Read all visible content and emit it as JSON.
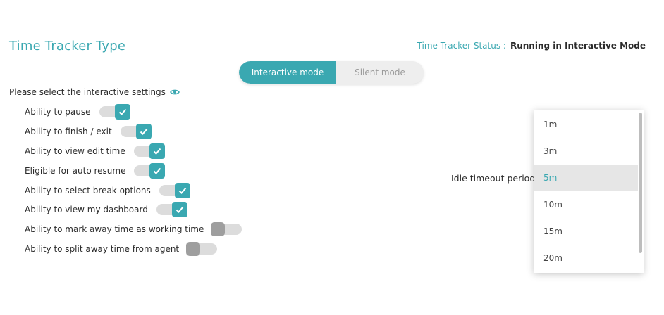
{
  "header": {
    "title": "Time Tracker Type",
    "status_label": "Time Tracker Status :",
    "status_value": "Running in Interactive Mode"
  },
  "mode_toggle": {
    "options": [
      {
        "label": "Interactive mode",
        "active": true
      },
      {
        "label": "Silent mode",
        "active": false
      }
    ]
  },
  "settings": {
    "section_label": "Please select the interactive settings",
    "section_icon": "eye-icon",
    "items": [
      {
        "label": "Ability to pause",
        "enabled": true
      },
      {
        "label": "Ability to finish / exit",
        "enabled": true
      },
      {
        "label": "Ability to view edit time",
        "enabled": true
      },
      {
        "label": "Eligible for auto resume",
        "enabled": true
      },
      {
        "label": "Ability to select break options",
        "enabled": true
      },
      {
        "label": "Ability to view my dashboard",
        "enabled": true
      },
      {
        "label": "Ability to mark away time as working time",
        "enabled": false
      },
      {
        "label": "Ability to split away time from agent",
        "enabled": false
      }
    ]
  },
  "idle_timeout": {
    "label": "Idle timeout period",
    "options": [
      "1m",
      "3m",
      "5m",
      "10m",
      "15m",
      "20m"
    ],
    "selected": "5m"
  },
  "colors": {
    "accent": "#3aa8b1",
    "toggle_track": "#dcdcdc",
    "toggle_off_knob": "#9e9e9e"
  }
}
